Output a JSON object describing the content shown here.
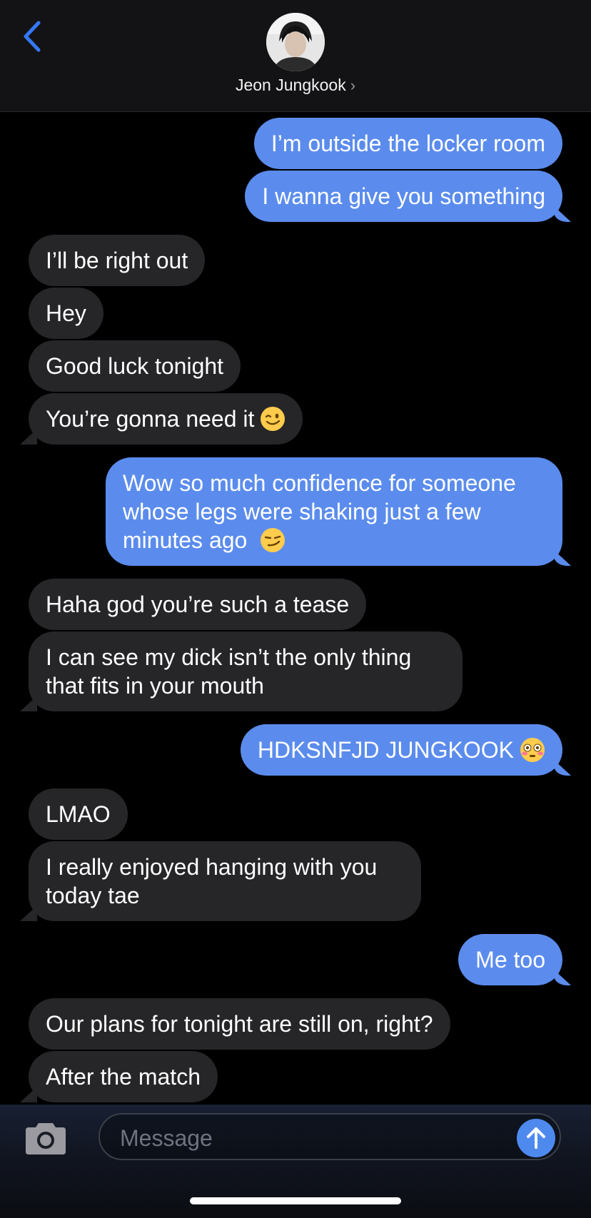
{
  "header": {
    "contact_name": "Jeon Jungkook",
    "chevron": "›",
    "back_icon": "chevron-left-icon",
    "accent_color": "#3478f6"
  },
  "messages": [
    {
      "from": "me",
      "text": "I’m outside the locker room"
    },
    {
      "from": "me",
      "text": "I wanna give you something"
    },
    {
      "from": "them",
      "text": "I’ll be right out"
    },
    {
      "from": "them",
      "text": "Hey"
    },
    {
      "from": "them",
      "text": "Good luck tonight"
    },
    {
      "from": "them",
      "text": "You’re gonna need it",
      "emoji": "winking-face-emoji"
    },
    {
      "from": "me",
      "text": "Wow so much confidence for someone\nwhose legs were shaking just a few\nminutes ago",
      "emoji": "smirking-face-emoji"
    },
    {
      "from": "them",
      "text": "Haha god you’re such a tease"
    },
    {
      "from": "them",
      "text": "I can see my dick isn’t the only thing\nthat fits in your mouth"
    },
    {
      "from": "me",
      "text": "HDKSNFJD JUNGKOOK",
      "emoji": "flushed-face-emoji"
    },
    {
      "from": "them",
      "text": "LMAO"
    },
    {
      "from": "them",
      "text": "I really enjoyed hanging with you\ntoday tae"
    },
    {
      "from": "me",
      "text": "Me too"
    },
    {
      "from": "them",
      "text": "Our plans for tonight are still on, right?"
    },
    {
      "from": "them",
      "text": "After the match"
    }
  ],
  "composer": {
    "placeholder": "Message",
    "value": "",
    "camera_icon": "camera-icon",
    "send_icon": "arrow-up-icon"
  },
  "colors": {
    "outgoing_bubble": "#5b8ced",
    "incoming_bubble": "#262629",
    "background": "#000000"
  }
}
